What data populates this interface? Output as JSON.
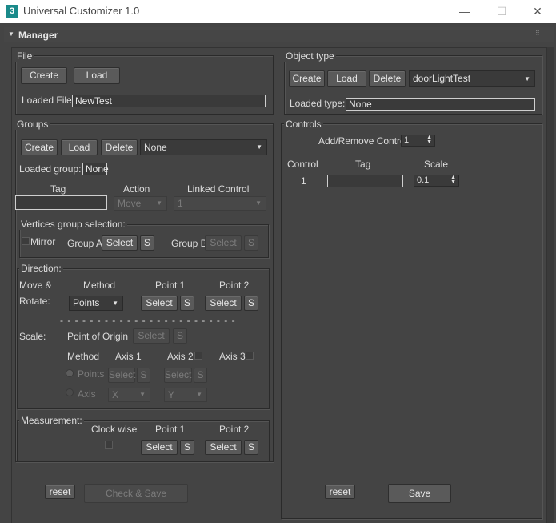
{
  "window": {
    "title": "Universal Customizer 1.0",
    "icon_text": "3",
    "minimize": "—",
    "maximize": "☐",
    "close": "✕"
  },
  "rollout": {
    "title": "Manager",
    "arrow": "▼",
    "grip": "⠿"
  },
  "file": {
    "label": "File",
    "create": "Create",
    "load": "Load",
    "loaded_label": "Loaded File:",
    "loaded_value": "NewTest"
  },
  "object_type": {
    "label": "Object type",
    "create": "Create",
    "load": "Load",
    "delete": "Delete",
    "selected": "doorLightTest",
    "loaded_label": "Loaded type:",
    "loaded_value": "None"
  },
  "groups": {
    "label": "Groups",
    "create": "Create",
    "load": "Load",
    "delete": "Delete",
    "selected": "None",
    "loaded_label": "Loaded group:",
    "loaded_value": "None",
    "tag_label": "Tag",
    "action_label": "Action",
    "linked_label": "Linked Control",
    "action_value": "Move",
    "linked_value": "1",
    "tag_value": ""
  },
  "vertices": {
    "label": "Vertices group selection:",
    "mirror": "Mirror",
    "group_a": "Group A",
    "group_b": "Group B",
    "select": "Select",
    "s": "S"
  },
  "direction": {
    "label": "Direction:",
    "move_label": "Move &",
    "rotate_label": "Rotate:",
    "method_label": "Method",
    "point1": "Point 1",
    "point2": "Point 2",
    "method_value": "Points",
    "select": "Select",
    "s": "S",
    "separator": "- - - - - - - - - - - - - - - - - - - - - - - -",
    "scale_label": "Scale:",
    "origin_label": "Point of Origin",
    "method2_label": "Method",
    "axis1": "Axis 1",
    "axis2": "Axis 2",
    "axis3": "Axis 3",
    "points_radio": "Points",
    "axis_radio": "Axis",
    "x_value": "X",
    "y_value": "Y"
  },
  "measurement": {
    "label": "Measurement:",
    "clockwise": "Clock wise",
    "point1": "Point 1",
    "point2": "Point 2",
    "select": "Select",
    "s": "S"
  },
  "left_footer": {
    "reset": "reset",
    "check_save": "Check & Save"
  },
  "controls": {
    "label": "Controls",
    "add_remove_label": "Add/Remove Control",
    "count": "1",
    "col_control": "Control",
    "col_tag": "Tag",
    "col_scale": "Scale",
    "row_index": "1",
    "row_tag": "",
    "row_scale": "0.1",
    "reset": "reset",
    "save": "Save"
  },
  "icons": {
    "dropdown": "chevron-down-icon",
    "spinner": "spinner-arrows-icon"
  },
  "colors": {
    "background": "#444444",
    "titlebar": "#ffffff",
    "field_border": "#cfcfcf"
  }
}
